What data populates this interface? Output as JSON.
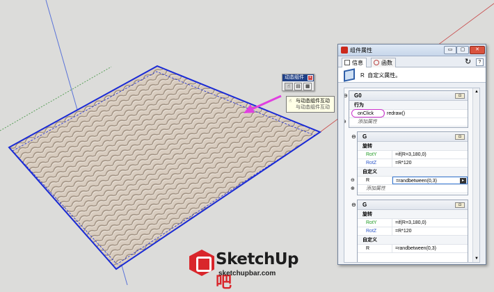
{
  "colors": {
    "background": "#dcdcda",
    "selection_blue": "#1a2bd6",
    "tile_fill": "#d7cbbf",
    "highlight_magenta": "#cc33cc",
    "logo_red": "#d9262b"
  },
  "dc_toolbar": {
    "title": "动态组件",
    "close_icon": "close-icon",
    "buttons": [
      "interact-icon",
      "component-options-icon",
      "component-attributes-icon"
    ]
  },
  "tooltip": {
    "line1": "与动态组件互动",
    "line2": "与动态组件互动"
  },
  "window": {
    "title": "组件属性",
    "min_label": "▭",
    "max_label": "▢",
    "close_label": "✕",
    "tabs": [
      {
        "label": "信息",
        "icon": "info-icon"
      },
      {
        "label": "函数",
        "icon": "function-icon"
      }
    ],
    "refresh_label": "↻",
    "help_label": "?",
    "component_name": "R",
    "component_desc": "自定义属性。",
    "blocks": [
      {
        "name": "G0",
        "sections": [
          {
            "title": "行为",
            "rows": [
              {
                "key": "onClick",
                "value": "redraw()",
                "color": "black"
              }
            ]
          }
        ],
        "add_label": "添加属性"
      },
      {
        "name": "G",
        "sections": [
          {
            "title": "旋转",
            "rows": [
              {
                "key": "RotY",
                "value": "=if(R=3,180,0)",
                "color": "green"
              },
              {
                "key": "RotZ",
                "value": "=R*120",
                "color": "blue"
              }
            ]
          },
          {
            "title": "自定义",
            "rows": [
              {
                "key": "R",
                "value": "=randbetween(0,3)",
                "color": "black"
              }
            ]
          }
        ],
        "add_label": "添加属性"
      },
      {
        "name": "G",
        "sections": [
          {
            "title": "旋转",
            "rows": [
              {
                "key": "RotY",
                "value": "=if(R=3,180,0)",
                "color": "green"
              },
              {
                "key": "RotZ",
                "value": "=R*120",
                "color": "blue"
              }
            ]
          },
          {
            "title": "自定义",
            "rows": [
              {
                "key": "R",
                "value": "=randbetween(0,3)",
                "color": "black"
              }
            ]
          }
        ]
      }
    ],
    "pin_label": "⊡",
    "expand_minus": "⊖",
    "expand_plus": "⊕"
  },
  "logo": {
    "word_main": "SketchUp",
    "word_tail": "吧",
    "site": "sketchupbar.com"
  }
}
